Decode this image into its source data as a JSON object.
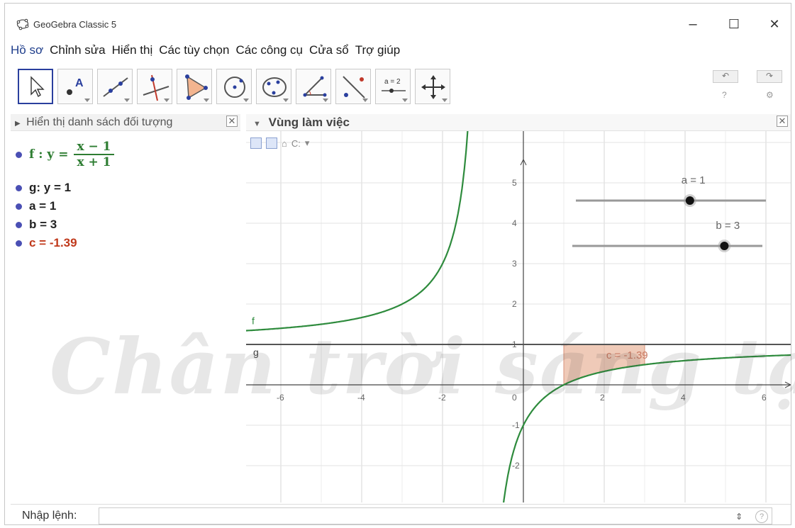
{
  "window": {
    "title": "GeoGebra Classic 5",
    "minimize_glyph": "–",
    "maximize_glyph": "☐",
    "close_glyph": "✕"
  },
  "menu": [
    "Hồ sơ",
    "Chỉnh sửa",
    "Hiển thị",
    "Các tùy chọn",
    "Các công cụ",
    "Cửa sổ",
    "Trợ giúp"
  ],
  "toolbar": {
    "tools": [
      {
        "name": "move-tool",
        "icon": "cursor-arrow-icon"
      },
      {
        "name": "point-tool",
        "icon": "point-icon"
      },
      {
        "name": "line-tool",
        "icon": "line-icon"
      },
      {
        "name": "perpendicular-tool",
        "icon": "perpendicular-line-icon"
      },
      {
        "name": "polygon-tool",
        "icon": "polygon-icon"
      },
      {
        "name": "circle-tool",
        "icon": "circle-center-icon"
      },
      {
        "name": "conic-tool",
        "icon": "ellipse-icon"
      },
      {
        "name": "angle-tool",
        "icon": "angle-icon"
      },
      {
        "name": "reflect-tool",
        "icon": "reflect-icon"
      },
      {
        "name": "slider-tool",
        "icon": "slider-icon",
        "label": "a = 2"
      },
      {
        "name": "move-graphics-tool",
        "icon": "move-graphics-icon"
      }
    ],
    "undo_glyph": "↶",
    "redo_glyph": "↷"
  },
  "algebra": {
    "header": "Hiển thị danh sách đối tượng",
    "close_glyph": "✕",
    "f_label": "f : y =",
    "f_numerator": "x − 1",
    "f_denominator": "x + 1",
    "items": [
      {
        "text": "g: y = 1",
        "color": "#111111"
      },
      {
        "text": "a = 1",
        "color": "#111111"
      },
      {
        "text": "b = 3",
        "color": "#111111"
      },
      {
        "text": "c = -1.39",
        "color": "#c0391b"
      }
    ]
  },
  "graphics": {
    "header": "Vùng làm việc",
    "toolbar_text": "C:",
    "close_glyph": "✕",
    "x_ticks": [
      "-6",
      "-4",
      "-2",
      "0",
      "2",
      "4",
      "6"
    ],
    "y_ticks": [
      "5",
      "4",
      "3",
      "2",
      "1",
      "-1",
      "-2"
    ],
    "slider_a": {
      "label": "a = 1",
      "value": 1
    },
    "slider_b": {
      "label": "b = 3",
      "value": 3
    },
    "curve_label": "f",
    "line_label": "g",
    "area_label": "c = -1.39"
  },
  "input": {
    "label": "Nhập lệnh:",
    "value": ""
  },
  "colors": {
    "curve": "#2e8b3d",
    "area_fill": "#e8b39a",
    "slider_track": "#999999",
    "accent": "#2a3f9e"
  },
  "watermark": "Chân trời sáng tạo"
}
